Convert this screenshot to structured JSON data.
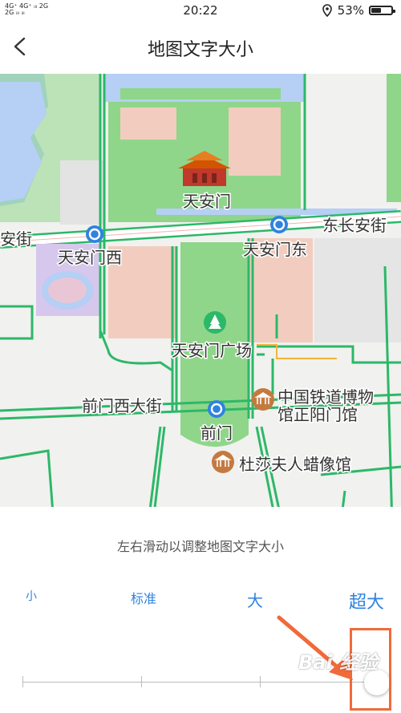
{
  "status_bar": {
    "signal_top": "4G⁺ 4G⁺ ᵢₗₗ 2G",
    "signal_bottom": "2G ᵢₗₗ ᵢₗₗ",
    "time": "20:22",
    "location_icon": "location-pin-icon",
    "battery_percent": "53%",
    "battery_level": 0.53
  },
  "header": {
    "title": "地图文字大小",
    "back_icon": "chevron-left-icon"
  },
  "map": {
    "labels": {
      "tiananmen": "天安门",
      "west_road": "安街",
      "east_road": "东长安街",
      "tiananmen_west": "天安门西",
      "tiananmen_east": "天安门东",
      "square": "天安门广场",
      "qianmen_west": "前门西大街",
      "qianmen": "前门",
      "museum_line1": "中国铁道博物",
      "museum_line2": "馆正阳门馆",
      "wax_museum": "杜莎夫人蜡像馆"
    },
    "colors": {
      "background": "#f1f1ef",
      "green_area": "#8fd68a",
      "road_outline": "#2cb868",
      "road_fill": "#ffffff",
      "water": "#b5cff5",
      "building": "#f2cdbf",
      "purple_area": "#d6c7ec",
      "metro": "#2f82e0",
      "poi_brown": "#c47a3f"
    }
  },
  "panel": {
    "hint": "左右滑动以调整地图文字大小",
    "size_options": [
      "小",
      "标准",
      "大",
      "超大"
    ],
    "selected_option": "超大",
    "slider_level": 1.0
  },
  "annotation": {
    "watermark": "Bai 经验",
    "color": "#f06a3a"
  }
}
